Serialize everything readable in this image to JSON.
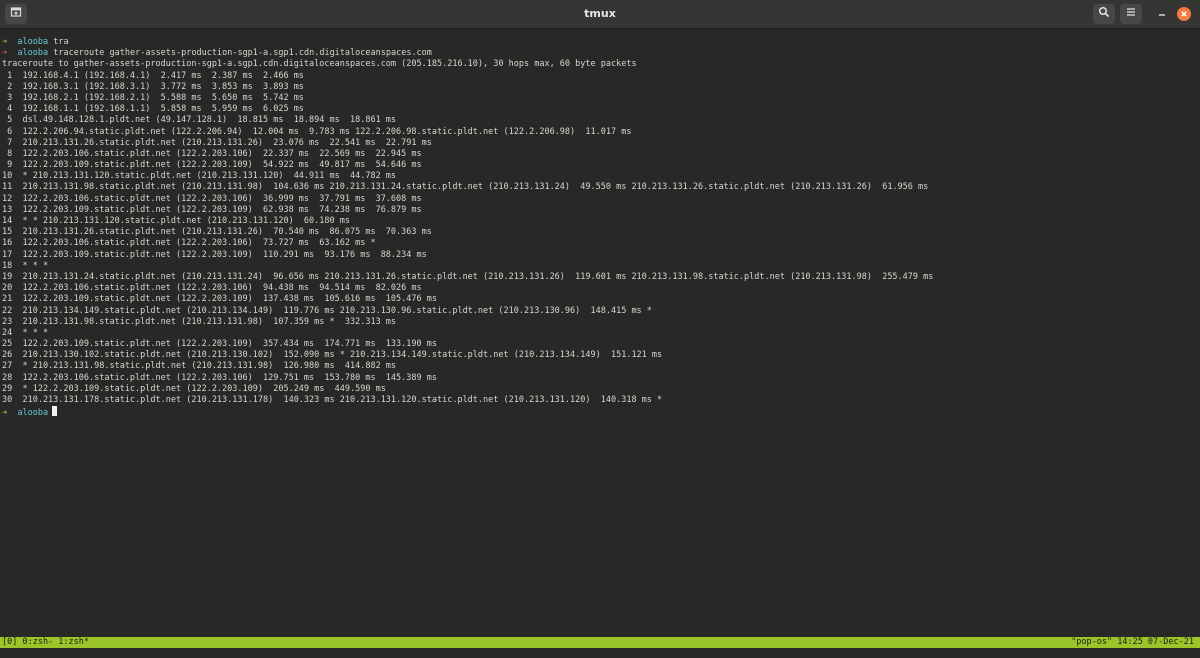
{
  "window": {
    "title": "tmux"
  },
  "icons": {
    "new_tab": "new-tab-icon",
    "search": "search-icon",
    "menu": "hamburger-menu-icon",
    "minimize": "minimize-icon",
    "close": "close-icon"
  },
  "colors": {
    "prompt_arrow": "#8ccf3f",
    "prompt_user": "#66c6d6",
    "status_bar": "#9ac62a",
    "close_button": "#f17b3e"
  },
  "terminal": {
    "prompt_user": "alooba",
    "cmd1": "tra",
    "cmd2": "traceroute gather-assets-production-sgp1-a.sgp1.cdn.digitaloceanspaces.com",
    "output": [
      "traceroute to gather-assets-production-sgp1-a.sgp1.cdn.digitaloceanspaces.com (205.185.216.10), 30 hops max, 60 byte packets",
      " 1  192.168.4.1 (192.168.4.1)  2.417 ms  2.387 ms  2.466 ms",
      " 2  192.168.3.1 (192.168.3.1)  3.772 ms  3.853 ms  3.893 ms",
      " 3  192.168.2.1 (192.168.2.1)  5.588 ms  5.650 ms  5.742 ms",
      " 4  192.168.1.1 (192.168.1.1)  5.858 ms  5.959 ms  6.025 ms",
      " 5  dsl.49.148.128.1.pldt.net (49.147.128.1)  18.815 ms  18.894 ms  18.861 ms",
      " 6  122.2.206.94.static.pldt.net (122.2.206.94)  12.004 ms  9.783 ms 122.2.206.98.static.pldt.net (122.2.206.98)  11.017 ms",
      " 7  210.213.131.26.static.pldt.net (210.213.131.26)  23.076 ms  22.541 ms  22.791 ms",
      " 8  122.2.203.106.static.pldt.net (122.2.203.106)  22.337 ms  22.569 ms  22.945 ms",
      " 9  122.2.203.109.static.pldt.net (122.2.203.109)  54.922 ms  49.817 ms  54.646 ms",
      "10  * 210.213.131.120.static.pldt.net (210.213.131.120)  44.911 ms  44.782 ms",
      "11  210.213.131.98.static.pldt.net (210.213.131.98)  104.636 ms 210.213.131.24.static.pldt.net (210.213.131.24)  49.550 ms 210.213.131.26.static.pldt.net (210.213.131.26)  61.956 ms",
      "12  122.2.203.106.static.pldt.net (122.2.203.106)  36.999 ms  37.791 ms  37.608 ms",
      "13  122.2.203.109.static.pldt.net (122.2.203.109)  62.938 ms  74.238 ms  76.879 ms",
      "14  * * 210.213.131.120.static.pldt.net (210.213.131.120)  60.180 ms",
      "15  210.213.131.26.static.pldt.net (210.213.131.26)  70.540 ms  86.075 ms  70.363 ms",
      "16  122.2.203.106.static.pldt.net (122.2.203.106)  73.727 ms  63.162 ms *",
      "17  122.2.203.109.static.pldt.net (122.2.203.109)  110.291 ms  93.176 ms  88.234 ms",
      "18  * * *",
      "19  210.213.131.24.static.pldt.net (210.213.131.24)  96.656 ms 210.213.131.26.static.pldt.net (210.213.131.26)  119.601 ms 210.213.131.98.static.pldt.net (210.213.131.98)  255.479 ms",
      "20  122.2.203.106.static.pldt.net (122.2.203.106)  94.438 ms  94.514 ms  82.026 ms",
      "21  122.2.203.109.static.pldt.net (122.2.203.109)  137.438 ms  105.616 ms  105.476 ms",
      "22  210.213.134.149.static.pldt.net (210.213.134.149)  119.776 ms 210.213.130.96.static.pldt.net (210.213.130.96)  148.415 ms *",
      "23  210.213.131.98.static.pldt.net (210.213.131.98)  107.359 ms *  332.313 ms",
      "24  * * *",
      "25  122.2.203.109.static.pldt.net (122.2.203.109)  357.434 ms  174.771 ms  133.190 ms",
      "26  210.213.130.102.static.pldt.net (210.213.130.102)  152.090 ms * 210.213.134.149.static.pldt.net (210.213.134.149)  151.121 ms",
      "27  * 210.213.131.98.static.pldt.net (210.213.131.98)  126.980 ms  414.882 ms",
      "28  122.2.203.106.static.pldt.net (122.2.203.106)  129.751 ms  153.780 ms  145.389 ms",
      "29  * 122.2.203.109.static.pldt.net (122.2.203.109)  205.249 ms  449.590 ms",
      "30  210.213.131.178.static.pldt.net (210.213.131.178)  140.323 ms 210.213.131.120.static.pldt.net (210.213.131.120)  140.318 ms *"
    ]
  },
  "status_bar": {
    "left": "[0] 0:zsh- 1:zsh*",
    "right": "\"pop-os\" 14:25 07-Dec-21"
  }
}
